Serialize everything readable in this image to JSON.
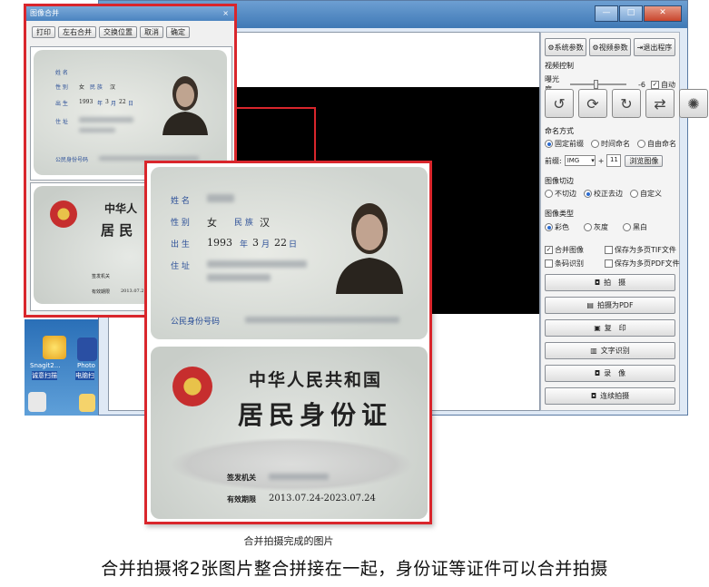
{
  "dialog": {
    "title": "图像合并",
    "close": "×",
    "toolbar": [
      "打印",
      "左右合并",
      "交换位置",
      "取消",
      "确定"
    ]
  },
  "panel": {
    "top_buttons": [
      "系统参数",
      "视频参数",
      "退出程序"
    ],
    "video_control_label": "视频控制",
    "exposure_label": "曝光度",
    "exposure_value": "-6",
    "auto_label": "自动",
    "naming_label": "命名方式",
    "naming_options": [
      "固定前缀",
      "时间命名",
      "自由命名"
    ],
    "prefix_label": "前缀:",
    "prefix_value": "IMG",
    "plus": "+",
    "counter": "11",
    "browse_button": "浏览图像",
    "crop_label": "图像切边",
    "crop_options": [
      "不切边",
      "校正去边",
      "自定义"
    ],
    "type_label": "图像类型",
    "type_options": [
      "彩色",
      "灰度",
      "黑白"
    ],
    "checks": [
      "合并图像",
      "保存为多页TIF文件",
      "条码识别",
      "保存为多页PDF文件"
    ],
    "actions": [
      "拍　摄",
      "拍摄为PDF",
      "复　印",
      "文字识别",
      "录　像",
      "连续拍摄"
    ]
  },
  "desktop": {
    "icons": [
      "Snagit2...",
      "Photo",
      "诚意扫描",
      "电脑扫"
    ]
  },
  "card": {
    "name_label": "姓 名",
    "sex_label": "性 别",
    "sex_value": "女",
    "ethnic_label": "民 族",
    "ethnic_value": "汉",
    "birth_label": "出 生",
    "birth_year": "1993",
    "year_char": "年",
    "birth_month": "3",
    "month_char": "月",
    "birth_day": "22",
    "day_char": "日",
    "address_label": "住 址",
    "id_label": "公民身份号码",
    "back_title_1": "中华人民共和国",
    "back_title_2": "居民身份证",
    "thumb_back_1": "中华人",
    "thumb_back_2": "居 民",
    "issuer_label": "签发机关",
    "validity_label": "有效期限",
    "validity_value": "2013.07.24-2023.07.24",
    "validity_short": "2013.07.2"
  },
  "captions": {
    "small": "合并拍摄完成的图片",
    "big": "合并拍摄将2张图片整合拼接在一起，身份证等证件可以合并拍摄"
  },
  "colors": {
    "highlight": "#d9262c",
    "card_text": "#2a4e97"
  }
}
